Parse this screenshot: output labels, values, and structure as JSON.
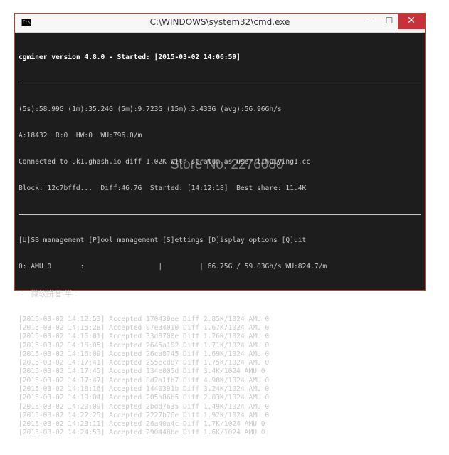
{
  "window": {
    "title": "C:\\WINDOWS\\system32\\cmd.exe",
    "icon": "C:\\",
    "buttons": {
      "minimize": "–",
      "maximize": "☐",
      "close": "✕"
    }
  },
  "console": {
    "header": "cgminer version 4.8.0 - Started: [2015-03-02 14:06:59]",
    "stats": [
      "(5s):58.99G (1m):35.24G (5m):9.723G (15m):3.433G (avg):56.96Gh/s",
      "A:18432  R:0  HW:0  WU:796.0/m",
      "Connected to uk1.ghash.io diff 1.02K with stratum as user lihuiying1.cc",
      "Block: 12c7bffd...  Diff:46.7G  Started: [14:12:18]  Best share: 11.4K"
    ],
    "menu": "[U]SB management [P]ool management [S]ettings [D]isplay options [Q]uit",
    "device": "0: AMU 0       :                  |         | 66.75G / 59.03Gh/s WU:824.7/m",
    "log": [
      "[2015-03-02 14:12:53] Accepted 170439ee Diff 2.85K/1024 AMU 0",
      "[2015-03-02 14:15:28] Accepted 07e34010 Diff 1.67K/1024 AMU 0",
      "[2015-03-02 14:16:01] Accepted 33d8700e Diff 1.26K/1024 AMU 0",
      "[2015-03-02 14:16:05] Accepted 2645a102 Diff 1.71K/1024 AMU 0",
      "[2015-03-02 14:16:09] Accepted 26ca8745 Diff 1.69K/1024 AMU 0",
      "[2015-03-02 14:17:41] Accepted 255ecd87 Diff 1.75K/1024 AMU 0",
      "[2015-03-02 14:17:45] Accepted 134e005d Diff 3.4K/1024 AMU 0",
      "[2015-03-02 14:17:47] Accepted 0d2a1fb7 Diff 4.98K/1024 AMU 0",
      "[2015-03-02 14:18:16] Accepted 1440391b Diff 3.24K/1024 AMU 0",
      "[2015-03-02 14:19:04] Accepted 205a86b5 Diff 2.03K/1024 AMU 0",
      "[2015-03-02 14:20:09] Accepted 2bdd7635 Diff 1.49K/1024 AMU 0",
      "[2015-03-02 14:22:25] Accepted 2227b76e Diff 1.92K/1024 AMU 0",
      "[2015-03-02 14:23:11] Accepted 26a40a4c Diff 1.7K/1024 AMU 0",
      "[2015-03-02 14:24:53] Accepted 290448be Diff 1.6K/1024 AMU 0"
    ]
  },
  "ime_status": "微软拼音 半 :",
  "watermark": "Store No: 2276080"
}
